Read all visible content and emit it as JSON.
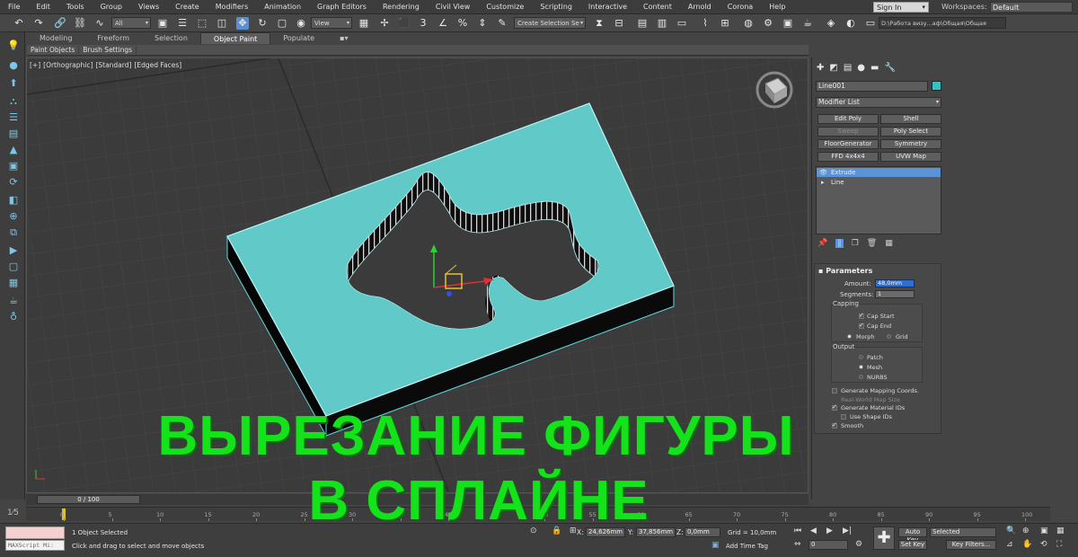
{
  "menubar": {
    "items": [
      "File",
      "Edit",
      "Tools",
      "Group",
      "Views",
      "Create",
      "Modifiers",
      "Animation",
      "Graph Editors",
      "Rendering",
      "Civil View",
      "Customize",
      "Scripting",
      "Interactive",
      "Content",
      "Arnold",
      "Corona",
      "Help"
    ],
    "sign_in": "Sign In",
    "workspaces_label": "Workspaces:",
    "workspaces_value": "Default"
  },
  "toolbar": {
    "selection_filter": "All",
    "ref_coord": "View",
    "named_selection": "Create Selection Se",
    "path": "D:\\Работа визу...аф\\Общая\\Общая"
  },
  "ribbon": {
    "tabs": [
      "Modeling",
      "Freeform",
      "Selection",
      "Object Paint",
      "Populate"
    ],
    "active_tab": "Object Paint",
    "sub_items": [
      "Paint Objects",
      "Brush Settings"
    ]
  },
  "viewport": {
    "label_parts": [
      "[+]",
      "[Orthographic]",
      "[Standard]",
      "[Edged Faces]"
    ]
  },
  "command_panel": {
    "object_name": "Line001",
    "object_color": "#32c4c4",
    "modifier_list": "Modifier List",
    "modifier_buttons": [
      "Edit Poly",
      "Shell",
      "Sweep",
      "Poly Select",
      "FloorGenerator",
      "Symmetry",
      "FFD 4x4x4",
      "UVW Map"
    ],
    "stack": [
      "Extrude",
      "Line"
    ],
    "parameters": {
      "title": "Parameters",
      "amount_label": "Amount:",
      "amount_value": "48,0mm",
      "segments_label": "Segments:",
      "segments_value": "1",
      "capping_label": "Capping",
      "cap_start": "Cap Start",
      "cap_end": "Cap End",
      "morph": "Morph",
      "grid": "Grid",
      "output_label": "Output",
      "patch": "Patch",
      "mesh": "Mesh",
      "nurbs": "NURBS",
      "gen_mapping": "Generate Mapping Coords.",
      "real_world": "Real-World Map Size",
      "gen_material": "Generate Material IDs",
      "use_shape": "Use Shape IDs",
      "smooth": "Smooth"
    }
  },
  "timeline": {
    "slider": "0 / 100",
    "ticks": [
      "0",
      "5",
      "10",
      "15",
      "20",
      "25",
      "30",
      "35",
      "40",
      "45",
      "50",
      "55",
      "60",
      "65",
      "70",
      "75",
      "80",
      "85",
      "90",
      "95",
      "100"
    ]
  },
  "statusbar": {
    "maxscript": "MAXScript Mi:",
    "selection": "1 Object Selected",
    "prompt": "Click and drag to select and move objects",
    "x_label": "X:",
    "x_value": "24,626mm",
    "y_label": "Y:",
    "y_value": "37,856mm",
    "z_label": "Z:",
    "z_value": "0,0mm",
    "grid": "Grid = 10,0mm",
    "add_time_tag": "Add Time Tag",
    "auto_key": "Auto Key",
    "set_key": "Set Key",
    "key_mode": "Selected",
    "key_filters": "Key Filters...",
    "frame": "0"
  },
  "overlay": {
    "line1": "ВЫРЕЗАНИЕ ФИГУРЫ",
    "line2": "В СПЛАЙНЕ"
  }
}
